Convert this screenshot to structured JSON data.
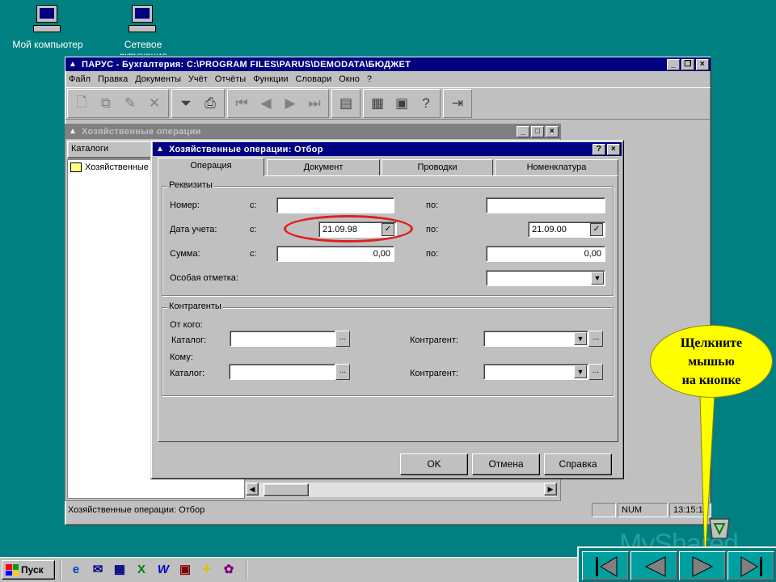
{
  "desktop": {
    "icons": [
      {
        "label": "Мой компьютер"
      },
      {
        "label": "Сетевое окружение"
      }
    ],
    "watermark": "MyShared"
  },
  "main_window": {
    "title": "ПАРУС - Бухгалтерия: C:\\PROGRAM FILES\\PARUS\\DEMODATA\\БЮДЖЕТ",
    "menu": [
      "Файл",
      "Правка",
      "Документы",
      "Учёт",
      "Отчёты",
      "Функции",
      "Словари",
      "Окно",
      "?"
    ],
    "status": {
      "text": "Хозяйственные операции: Отбор",
      "num": "NUM",
      "time": "13:15:1"
    }
  },
  "child_window": {
    "title": "Хозяйственные операции",
    "catalogs_header": "Каталоги",
    "tree_item": "Хозяйственные"
  },
  "dialog": {
    "title": "Хозяйственные операции: Отбор",
    "tabs": [
      "Операция",
      "Документ",
      "Проводки",
      "Номенклатура"
    ],
    "rekvizity": {
      "label": "Реквизиты",
      "rows": [
        {
          "label": "Номер:",
          "from_label": "с:",
          "from": "",
          "to_label": "по:",
          "to": ""
        },
        {
          "label": "Дата учета:",
          "from_label": "с:",
          "from": "21.09.98",
          "to_label": "по:",
          "to": "21.09.00"
        },
        {
          "label": "Сумма:",
          "from_label": "с:",
          "from": "0,00",
          "to_label": "по:",
          "to": "0,00"
        }
      ],
      "special_label": "Особая отметка:",
      "special_value": ""
    },
    "kontragenty": {
      "label": "Контрагенты",
      "from_label": "От кого:",
      "to_label": "Кому:",
      "catalog_label": "Каталог:",
      "contragent_label": "Контрагент:",
      "ellipsis": "..."
    },
    "buttons": {
      "ok": "OK",
      "cancel": "Отмена",
      "help": "Справка"
    },
    "help_title_btn": "?",
    "close_title_btn": "×"
  },
  "callout": {
    "lines": [
      "Щелкните",
      "мышью",
      "на кнопке"
    ]
  },
  "taskbar": {
    "start": "Пуск"
  },
  "colors": {
    "desktop": "#008080",
    "titlebar_active": "#000080",
    "callout": "#ffff00",
    "highlight_ring": "#e02020"
  }
}
